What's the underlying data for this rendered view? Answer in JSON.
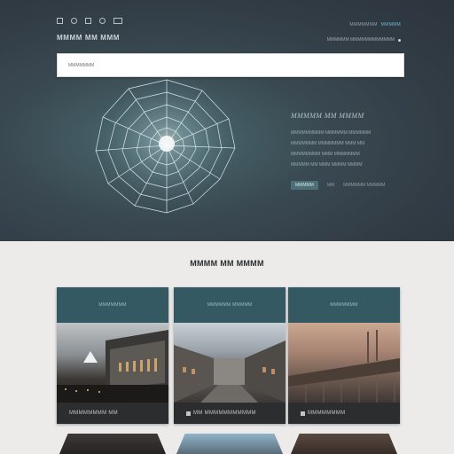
{
  "header": {
    "brand": "MMMM MM MMM",
    "login_prefix": "MMMMMMM",
    "login_link": "MMMMM",
    "contact": "MMMMMM MMMMMMMMMMMM"
  },
  "search": {
    "placeholder": "MMMMMMM"
  },
  "hero": {
    "title": "MMMMM MM MMMM",
    "text_lines": [
      "MMMMMMMMM MMMMMM MMMMMM",
      "MMMMMMM MMMMMMM MMM MM",
      "MMMMMMMM MMM MMMMMMM",
      "MMMMM MM MMM MMMM MMMM"
    ],
    "button": "MMMMM",
    "link1": "MM",
    "link2": "MMMMMM MMMMM"
  },
  "section": {
    "title": "MMMM MM MMMM"
  },
  "cards": [
    {
      "head": "MMMMMMM",
      "footer": "MMMMMMMM MM"
    },
    {
      "head": "MMMMMM MMMMM",
      "footer": "MM MMMMMMMMMMM"
    },
    {
      "head": "MMMMMMM",
      "footer": "MMMMMMMM"
    }
  ],
  "colors": {
    "hero_bg": "#323c45",
    "accent": "#6bb8d6",
    "card_header": "#345962",
    "card_body": "#2b2d2f",
    "page_bg": "#ecebea"
  }
}
